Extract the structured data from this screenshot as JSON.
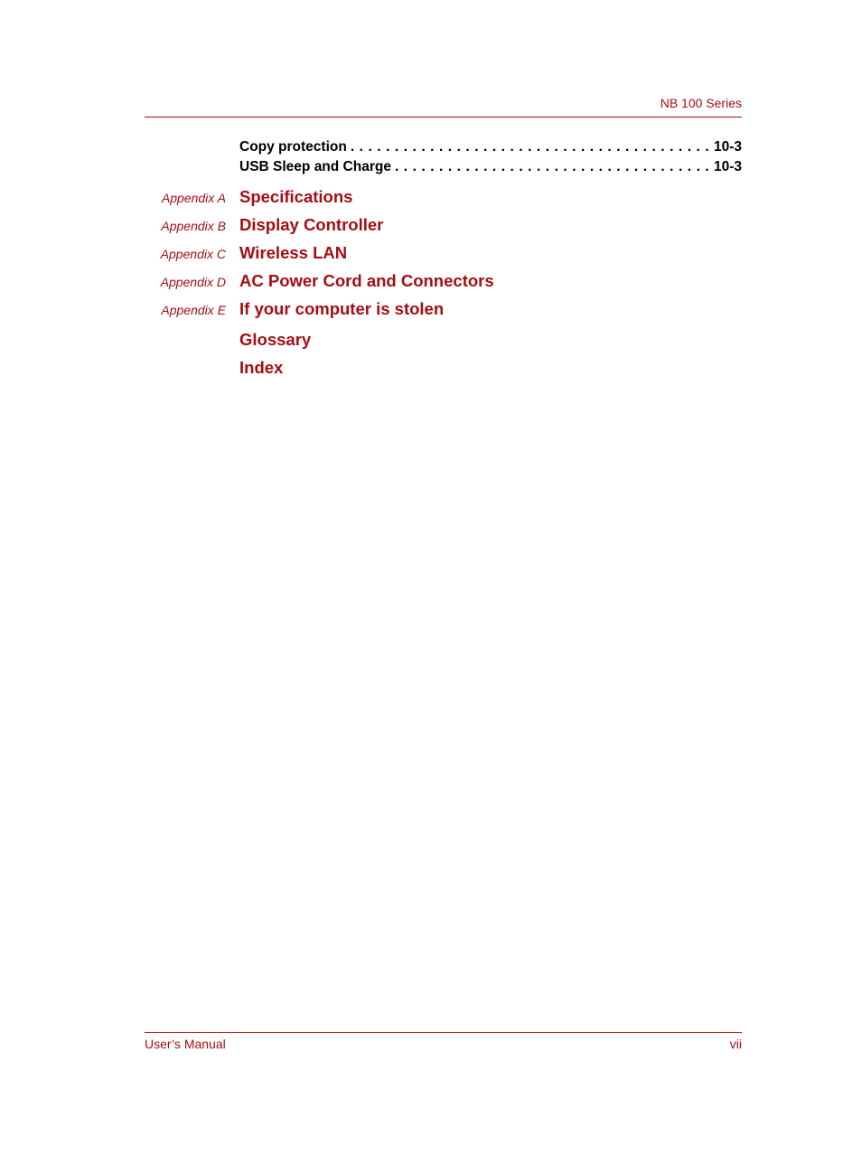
{
  "header": {
    "series_title": "NB 100 Series"
  },
  "toc_entries": [
    {
      "title": "Copy protection",
      "page": "10-3"
    },
    {
      "title": "USB Sleep and Charge",
      "page": "10-3"
    }
  ],
  "appendices": [
    {
      "label": "Appendix A",
      "title": "Specifications"
    },
    {
      "label": "Appendix B",
      "title": "Display Controller"
    },
    {
      "label": "Appendix C",
      "title": "Wireless LAN"
    },
    {
      "label": "Appendix D",
      "title": "AC Power Cord and Connectors"
    },
    {
      "label": "Appendix E",
      "title": "If your computer is stolen"
    },
    {
      "label": "",
      "title": "Glossary"
    },
    {
      "label": "",
      "title": "Index"
    }
  ],
  "footer": {
    "manual_label": "User’s Manual",
    "page_number": "vii"
  },
  "colors": {
    "accent": "#a50d12",
    "text": "#000000"
  }
}
